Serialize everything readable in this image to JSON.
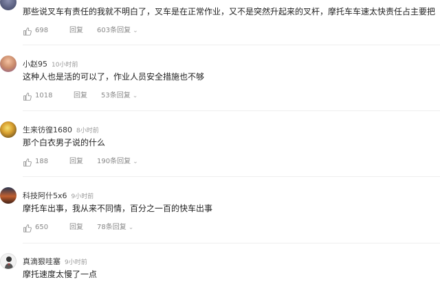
{
  "comments": [
    {
      "username": "",
      "time": "",
      "content": "那些说叉车有责任的我就不明白了，叉车是在正常作业，又不是突然升起来的叉杆，摩托车车速太快责任占主要把",
      "likes": "698",
      "reply_label": "回复",
      "replies_label": "603条回复"
    },
    {
      "username": "小赵95",
      "time": "10小时前",
      "content": "这种人也是活的可以了，作业人员安全措施也不够",
      "likes": "1018",
      "reply_label": "回复",
      "replies_label": "53条回复"
    },
    {
      "username": "生来彷徨1680",
      "time": "8小时前",
      "content": "那个白衣男子说的什么",
      "likes": "188",
      "reply_label": "回复",
      "replies_label": "190条回复"
    },
    {
      "username": "科技阿什5x6",
      "time": "9小时前",
      "content": "摩托车出事，我从来不同情，百分之一百的快车出事",
      "likes": "650",
      "reply_label": "回复",
      "replies_label": "78条回复"
    },
    {
      "username": "真滴狠哇塞",
      "time": "9小时前",
      "content": "摩托速度太慢了一点",
      "likes": "",
      "reply_label": "",
      "replies_label": ""
    }
  ],
  "icons": {
    "like": "thumbs-up-icon",
    "expand": "chevron-down-icon"
  }
}
